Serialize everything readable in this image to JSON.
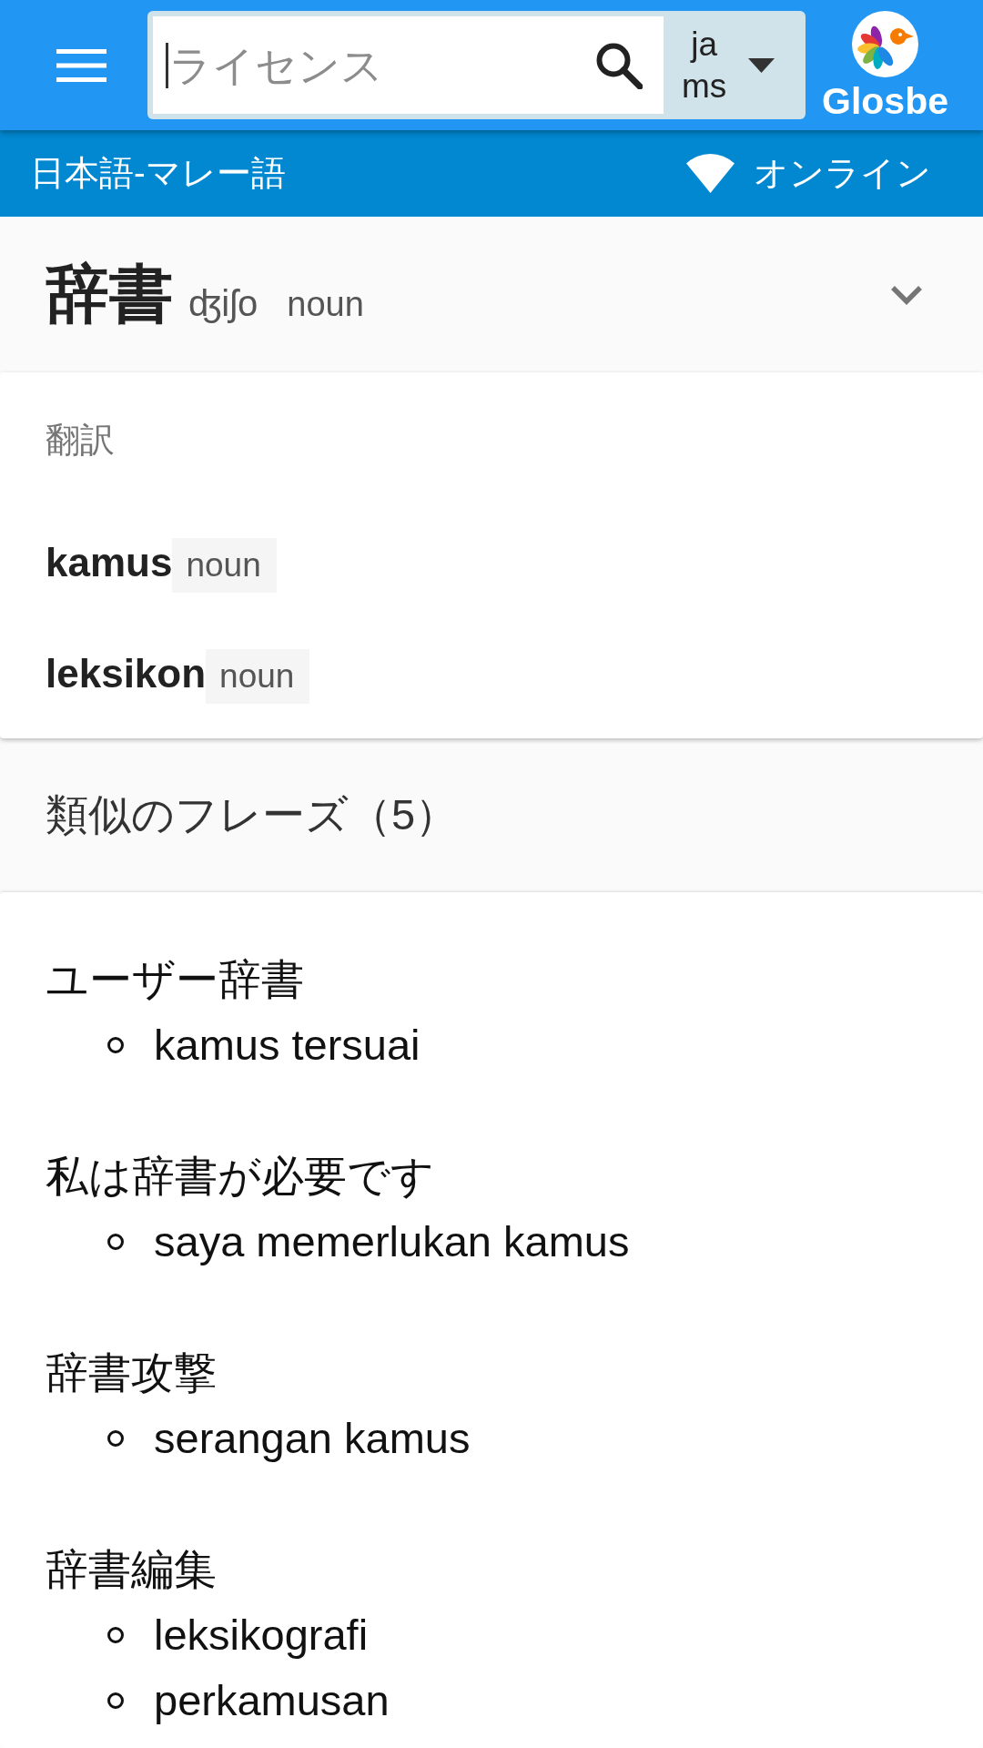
{
  "top_bar": {
    "search": {
      "placeholder": "ライセンス"
    },
    "language_selector": {
      "source": "ja",
      "target": "ms"
    },
    "logo_text": "Glosbe"
  },
  "sub_bar": {
    "dictionary": "日本語-マレー語",
    "connection": "オンライン"
  },
  "entry": {
    "headword": "辞書",
    "pronunciation": "ʤiʃo",
    "part_of_speech": "noun"
  },
  "translations": {
    "heading": "翻訳",
    "items": [
      {
        "word": "kamus",
        "part_of_speech": "noun"
      },
      {
        "word": "leksikon",
        "part_of_speech": "noun"
      }
    ]
  },
  "similar_phrases": {
    "heading": "類似のフレーズ（5）",
    "items": [
      {
        "phrase": "ユーザー辞書",
        "translations": [
          "kamus tersuai"
        ]
      },
      {
        "phrase": "私は辞書が必要です",
        "translations": [
          "saya memerlukan kamus"
        ]
      },
      {
        "phrase": "辞書攻撃",
        "translations": [
          "serangan kamus"
        ]
      },
      {
        "phrase": "辞書編集",
        "translations": [
          "leksikografi",
          "perkamusan"
        ]
      }
    ]
  }
}
